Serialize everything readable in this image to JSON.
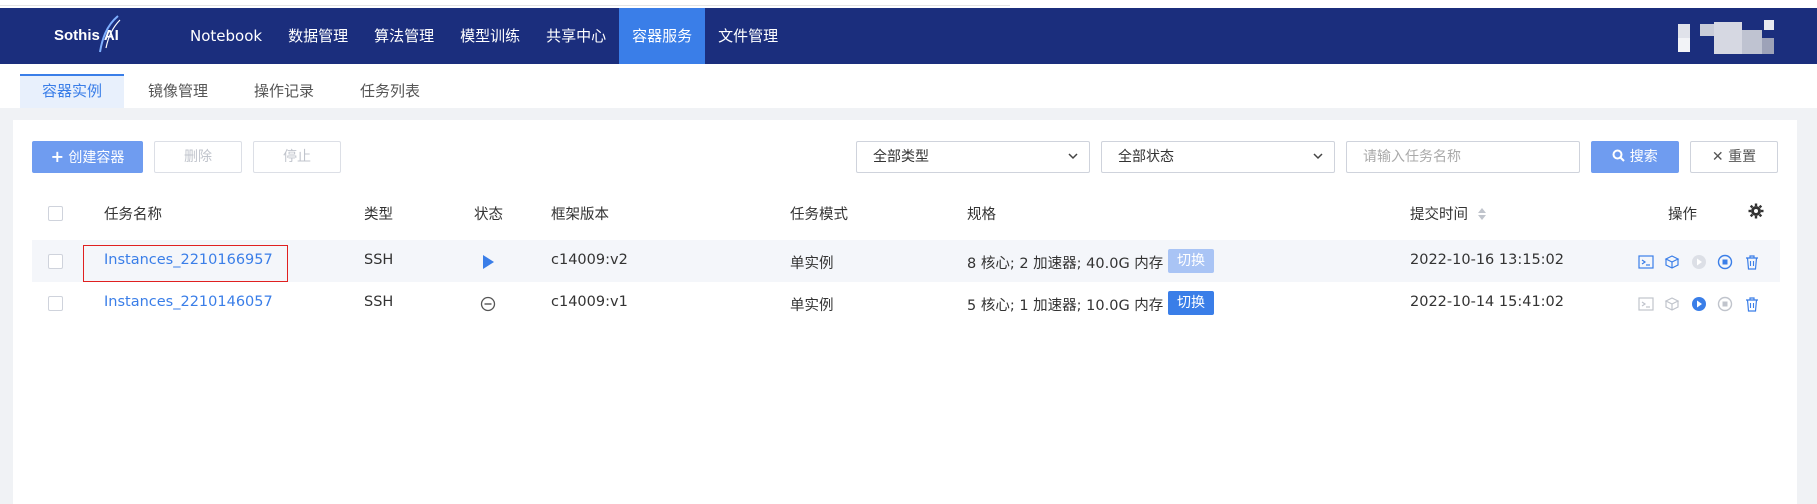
{
  "app": {
    "logo_text": "Sothis",
    "logo_suffix": "AI",
    "nav": [
      {
        "label": "Notebook",
        "active": false
      },
      {
        "label": "数据管理",
        "active": false
      },
      {
        "label": "算法管理",
        "active": false
      },
      {
        "label": "模型训练",
        "active": false
      },
      {
        "label": "共享中心",
        "active": false
      },
      {
        "label": "容器服务",
        "active": true
      },
      {
        "label": "文件管理",
        "active": false
      }
    ]
  },
  "subtabs": [
    {
      "label": "容器实例",
      "active": true
    },
    {
      "label": "镜像管理",
      "active": false
    },
    {
      "label": "操作记录",
      "active": false
    },
    {
      "label": "任务列表",
      "active": false
    }
  ],
  "toolbar": {
    "create_label": "创建容器",
    "delete_label": "删除",
    "stop_label": "停止",
    "type_select": "全部类型",
    "status_select": "全部状态",
    "search_placeholder": "请输入任务名称",
    "search_label": "搜索",
    "reset_label": "重置"
  },
  "table": {
    "headers": {
      "name": "任务名称",
      "type": "类型",
      "status": "状态",
      "framework": "框架版本",
      "mode": "任务模式",
      "spec": "规格",
      "submit_time": "提交时间",
      "actions": "操作"
    },
    "rows": [
      {
        "name": "Instances_2210166957",
        "type": "SSH",
        "status": "running",
        "framework": "c14009:v2",
        "mode": "单实例",
        "spec": "8 核心; 2 加速器; 40.0G 内存",
        "switch_label": "切换",
        "switch_enabled": false,
        "submit_time": "2022-10-16 13:15:02"
      },
      {
        "name": "Instances_2210146057",
        "type": "SSH",
        "status": "stopped",
        "framework": "c14009:v1",
        "mode": "单实例",
        "spec": "5 核心; 1 加速器; 10.0G 内存",
        "switch_label": "切换",
        "switch_enabled": true,
        "submit_time": "2022-10-14 15:41:02"
      }
    ]
  },
  "colors": {
    "topbar": "#1b2e7d",
    "accent": "#3a7ee8",
    "highlight": "#e02020"
  }
}
